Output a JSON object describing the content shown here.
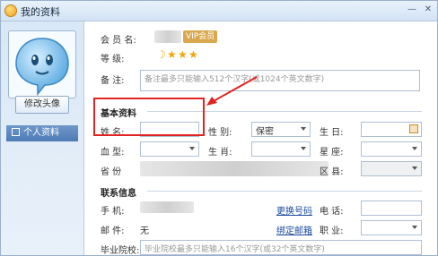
{
  "window": {
    "title": "我的资料"
  },
  "sidebar": {
    "change_avatar": "修改头像",
    "items": [
      {
        "label": "个人资料"
      }
    ]
  },
  "account": {
    "member_label": "会 员 名:",
    "vip_badge": "VIP会员",
    "level_label": "等    级:",
    "note_label": "备    注:",
    "note_placeholder": "备注最多只能输入512个汉字(或1024个英文数字)"
  },
  "basic": {
    "section_title": "基本资料",
    "name_label": "姓    名:",
    "gender_label": "性    别:",
    "gender_value": "保密",
    "birthday_label": "生    日:",
    "blood_label": "血    型:",
    "zodiac_label": "生    肖:",
    "constellation_label": "星    座:",
    "province_label": "省    份",
    "district_label": "区    县:"
  },
  "contact": {
    "section_title": "联系信息",
    "mobile_label": "手    机:",
    "change_number": "更换号码",
    "phone_label": "电    话:",
    "email_label": "邮    件:",
    "email_value": "无",
    "bind_email": "绑定邮箱",
    "job_label": "职    业:",
    "school_label": "毕业院校:",
    "school_placeholder": "毕业院校最多只能输入16个汉字(或32个英文数字)"
  },
  "colors": {
    "accent": "#4d7bb7",
    "highlight": "#e02424",
    "link": "#1a4aa0"
  }
}
